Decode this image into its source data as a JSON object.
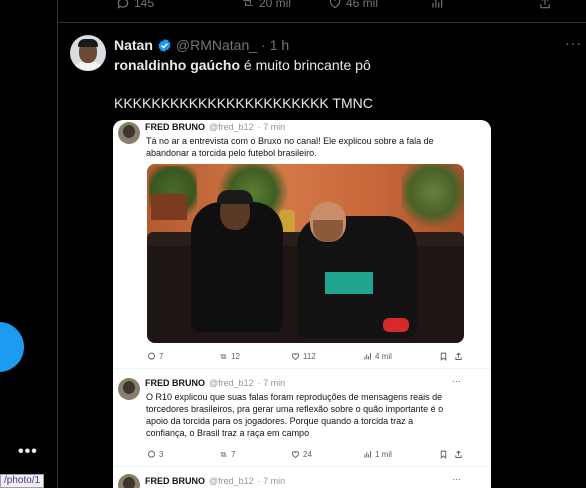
{
  "top_actions": {
    "reply_count": "145",
    "retweet_count": "20 mil",
    "like_count": "46 mil"
  },
  "tweet": {
    "display_name": "Natan",
    "handle": "@RMNatan_",
    "separator": "·",
    "time": "1 h",
    "text_bold": "ronaldinho gaúcho",
    "text_rest": " é muito brincante pô",
    "text_line2": "KKKKKKKKKKKKKKKKKKKKKKK TMNC"
  },
  "embed": {
    "post1": {
      "name": "FRED BRUNO",
      "handle": "@fred_b12",
      "time": "· 7 min",
      "text_lines": [
        "Tá no ar a entrevista com o Bruxo no canal! Ele explicou sobre a fala de",
        "abandonar a torcida pelo futebol brasileiro."
      ],
      "replies": "7",
      "retweets": "12",
      "likes": "112",
      "views": "4 mil"
    },
    "post2": {
      "name": "FRED BRUNO",
      "handle": "@fred_b12",
      "time": "· 7 min",
      "text_lines": [
        "O R10 explicou que suas falas foram reproduções de mensagens reais de",
        "torcedores brasileiros, pra gerar uma reflexão sobre o quão importante é o",
        "apoio da torcida para os jogadores. Porque quando a torcida traz a",
        "confiança, o Brasil traz a raça em campo"
      ],
      "replies": "3",
      "retweets": "7",
      "likes": "24",
      "views": "1 mil"
    },
    "post3": {
      "name": "FRED BRUNO",
      "handle": "@fred_b12",
      "time": "· 7 min"
    }
  },
  "url_tooltip": "/photo/1",
  "more_dots": "•••",
  "colors": {
    "accent": "#1d9bf0",
    "background": "#000000",
    "text": "#e7e9ea",
    "muted": "#71767b"
  }
}
